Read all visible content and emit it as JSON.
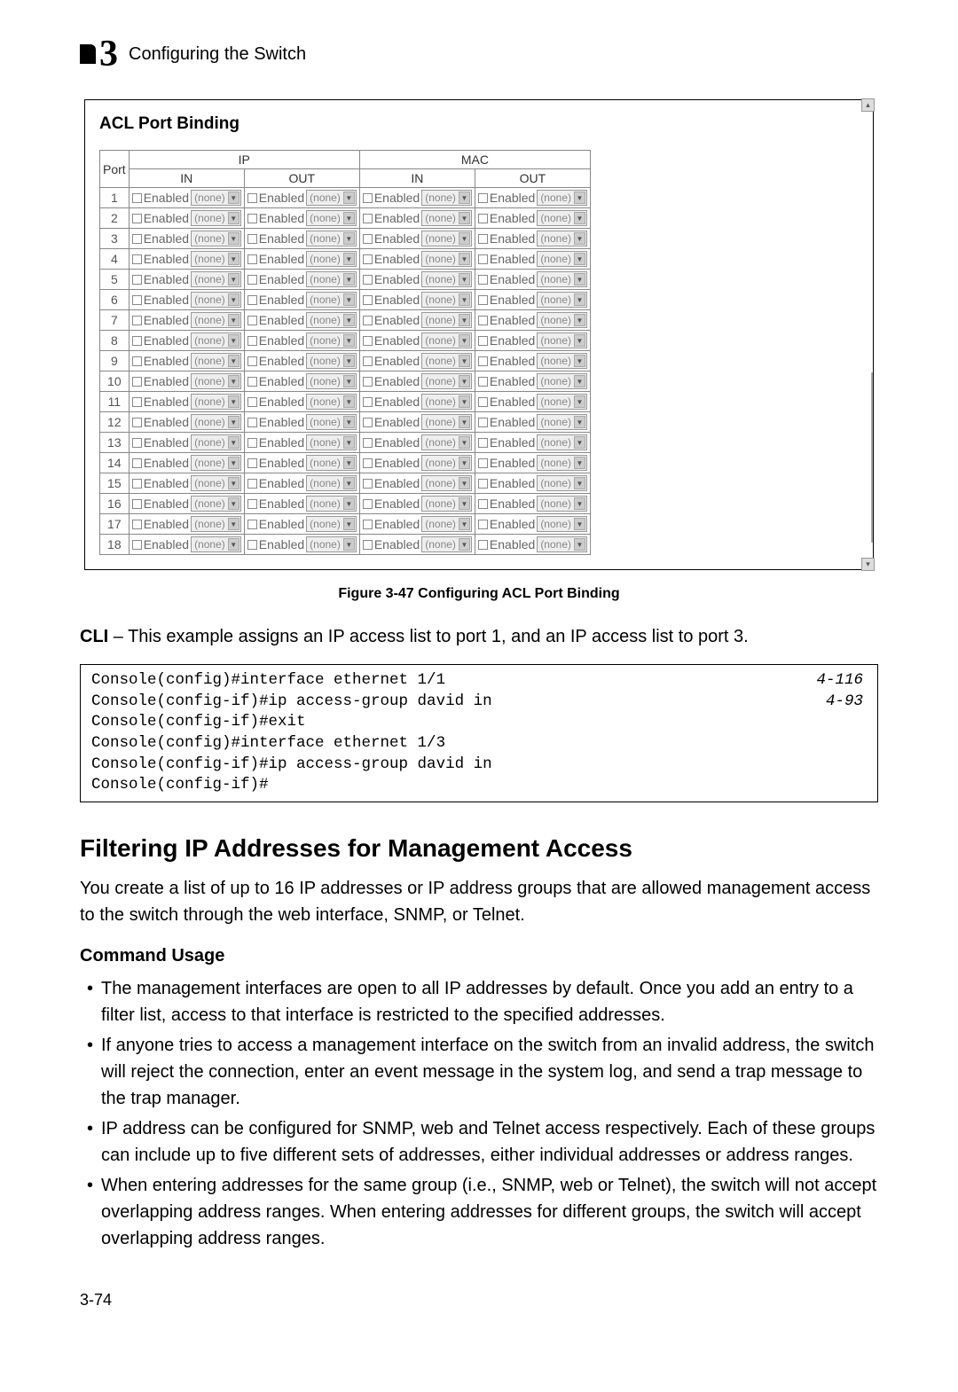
{
  "header": {
    "chapter_num": "3",
    "title": "Configuring the Switch"
  },
  "screenshot": {
    "title": "ACL Port Binding",
    "columns": {
      "port": "Port",
      "ip": "IP",
      "mac": "MAC",
      "in": "IN",
      "out": "OUT"
    },
    "enabled_label": "Enabled",
    "dropdown_value": "(none)",
    "ports": [
      1,
      2,
      3,
      4,
      5,
      6,
      7,
      8,
      9,
      10,
      11,
      12,
      13,
      14,
      15,
      16,
      17,
      18
    ]
  },
  "figure": {
    "caption": "Figure 3-47  Configuring ACL Port Binding"
  },
  "cli": {
    "intro_bold": "CLI",
    "intro_rest": " – This example assigns an IP access list to port 1, and an IP access list to port 3.",
    "lines": [
      {
        "cmd": "Console(config)#interface ethernet 1/1",
        "ref": "4-116"
      },
      {
        "cmd": "Console(config-if)#ip access-group david in",
        "ref": "4-93"
      },
      {
        "cmd": "Console(config-if)#exit",
        "ref": ""
      },
      {
        "cmd": "Console(config)#interface ethernet 1/3",
        "ref": ""
      },
      {
        "cmd": "Console(config-if)#ip access-group david in",
        "ref": ""
      },
      {
        "cmd": "Console(config-if)#",
        "ref": ""
      }
    ]
  },
  "section": {
    "heading": "Filtering IP Addresses for Management Access",
    "intro": "You create a list of up to 16 IP addresses or IP address groups that are allowed management access to the switch through the web interface, SNMP, or Telnet.",
    "subheading": "Command Usage",
    "bullets": [
      "The management interfaces are open to all IP addresses by default. Once you add an entry to a filter list, access to that interface is restricted to the specified addresses.",
      "If anyone tries to access a management interface on the switch from an invalid address, the switch will reject the connection, enter an event message in the system log, and send a trap message to the trap manager.",
      "IP address can be configured for SNMP, web and Telnet access respectively. Each of these groups can include up to five different sets of addresses, either individual addresses or address ranges.",
      "When entering addresses for the same group (i.e., SNMP, web or Telnet), the switch will not accept overlapping address ranges. When entering addresses for different groups, the switch will accept overlapping address ranges."
    ]
  },
  "page_number": "3-74"
}
